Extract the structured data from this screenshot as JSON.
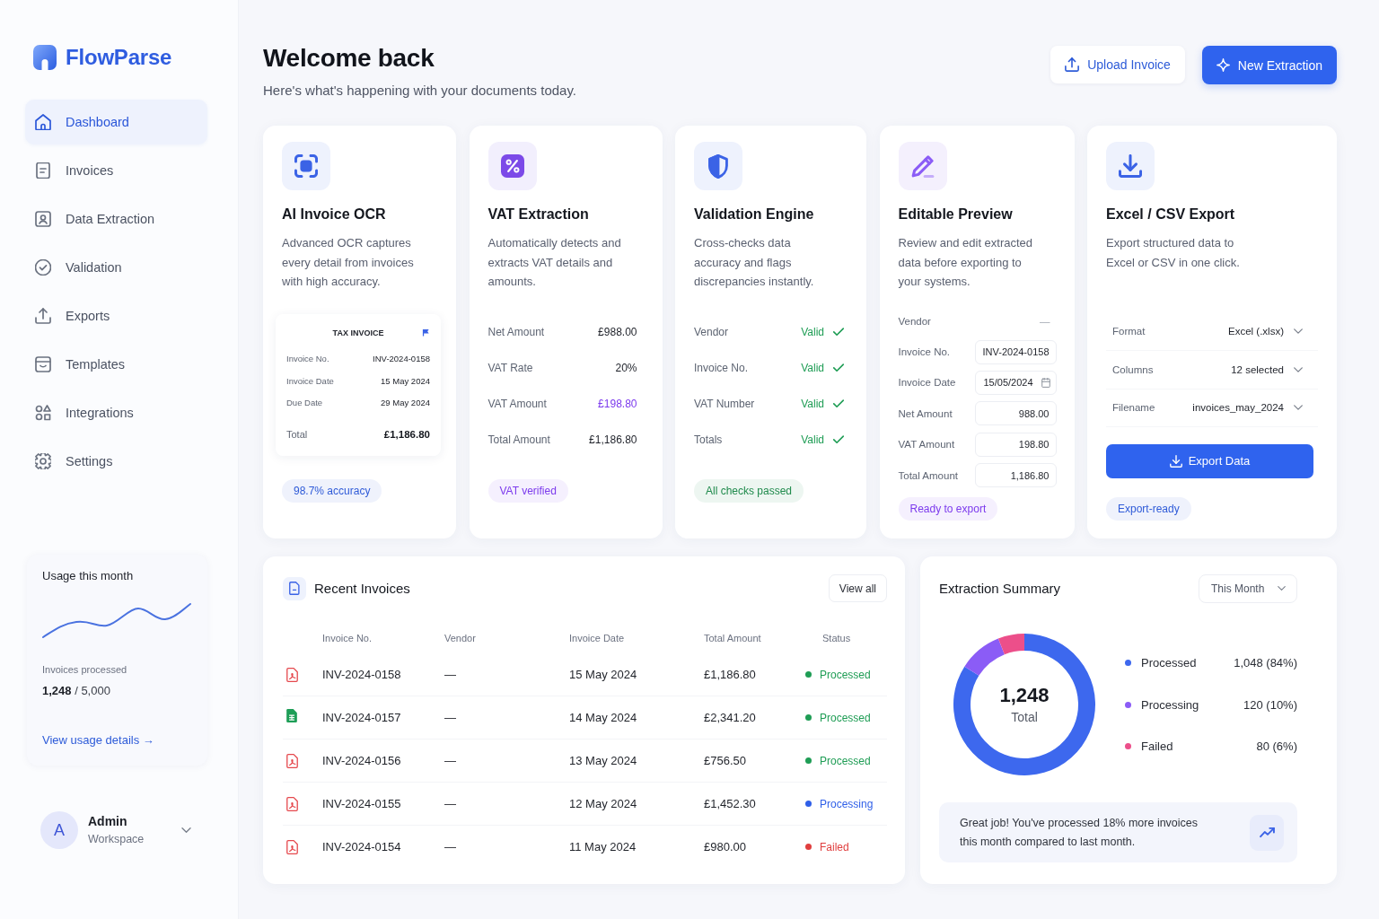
{
  "sidebar": {
    "brand": "FlowParse",
    "nav": [
      {
        "label": "Dashboard",
        "selected": true
      },
      {
        "label": "Invoices",
        "selected": false
      },
      {
        "label": "Data Extraction",
        "selected": false
      },
      {
        "label": "Validation",
        "selected": false
      },
      {
        "label": "Exports",
        "selected": false
      },
      {
        "label": "Templates",
        "selected": false
      },
      {
        "label": "Integrations",
        "selected": false
      },
      {
        "label": "Settings",
        "selected": false
      }
    ],
    "usage": {
      "title": "Usage this month",
      "caption": "Invoices processed",
      "count": "**1,248** / 5,000",
      "link": "View usage details →"
    },
    "user": {
      "initial": "A",
      "name": "Admin",
      "workspace": "Workspace"
    }
  },
  "header": {
    "title": "Welcome back",
    "subtitle": "Here's what's happening with your documents today.",
    "buttons": [
      {
        "label": "Upload Invoice",
        "kind": "secondary"
      },
      {
        "label": "New Extraction",
        "kind": "primary"
      }
    ]
  },
  "features": [
    {
      "kind": "ocr",
      "title": "AI Invoice OCR",
      "description": "Advanced OCR captures every detail from invoices with high accuracy.",
      "preview": {
        "heading": "TAX INVOICE",
        "rows": [
          {
            "label": "Invoice No.",
            "value": "INV-2024-0158"
          },
          {
            "label": "Invoice Date",
            "value": "15 May 2024"
          },
          {
            "label": "Due Date",
            "value": "29 May 2024"
          }
        ],
        "total": {
          "label": "Total",
          "value": "£1,186.80"
        }
      },
      "badge": {
        "label": "98.7% accuracy",
        "color": "#2f5bd8"
      }
    },
    {
      "kind": "amounts",
      "title": "VAT Extraction",
      "description": "Automatically detects and extracts VAT details and amounts.",
      "rows": [
        {
          "label": "Net Amount",
          "value": "£988.00",
          "accent": false
        },
        {
          "label": "VAT Rate",
          "value": "20%",
          "accent": false
        },
        {
          "label": "VAT Amount",
          "value": "£198.80",
          "accent": true
        },
        {
          "label": "Total Amount",
          "value": "£1,186.80",
          "accent": false
        }
      ],
      "badge": {
        "label": "VAT verified",
        "color": "#7c3aed"
      }
    },
    {
      "kind": "checks",
      "title": "Validation Engine",
      "description": "Cross-checks data accuracy and flags discrepancies instantly.",
      "rows": [
        {
          "label": "Vendor",
          "status": "Valid",
          "passed": true
        },
        {
          "label": "Invoice No.",
          "status": "Valid",
          "passed": true
        },
        {
          "label": "VAT Number",
          "status": "Valid",
          "passed": true
        },
        {
          "label": "Totals",
          "status": "Valid",
          "passed": true
        }
      ],
      "badge": {
        "label": "All checks passed",
        "color": "#1f8a4c"
      }
    },
    {
      "kind": "editable",
      "title": "Editable Preview",
      "description": "Review and edit extracted data before exporting to your systems.",
      "fields": [
        {
          "label": "Vendor",
          "value": "—",
          "kind": "text"
        },
        {
          "label": "Invoice No.",
          "value": "INV-2024-0158",
          "kind": "input"
        },
        {
          "label": "Invoice Date",
          "value": "15/05/2024",
          "kind": "date"
        },
        {
          "label": "Net Amount",
          "value": "988.00",
          "kind": "input"
        },
        {
          "label": "VAT Amount",
          "value": "198.80",
          "kind": "input"
        },
        {
          "label": "Total Amount",
          "value": "1,186.80",
          "kind": "input"
        }
      ],
      "badge": {
        "label": "Ready to export",
        "color": "#7c3aed"
      }
    },
    {
      "kind": "export",
      "title": "Excel / CSV Export",
      "description": "Export structured data to Excel or CSV in one click.",
      "fields": [
        {
          "label": "Format",
          "value": "Excel (.xlsx)"
        },
        {
          "label": "Columns",
          "value": "12 selected"
        },
        {
          "label": "Filename",
          "value": "invoices_may_2024"
        }
      ],
      "button": "Export Data",
      "badge": {
        "label": "Export-ready",
        "color": "#2f5bd8"
      }
    }
  ],
  "recent_invoices": {
    "title": "Recent Invoices",
    "action": "View all",
    "columns": [
      "Invoice No.",
      "Vendor",
      "Invoice Date",
      "Total Amount",
      "Status"
    ],
    "rows": [
      {
        "kind": "pdf",
        "invoice_no": "INV-2024-0158",
        "vendor": "—",
        "date": "15 May 2024",
        "amount": "£1,186.80",
        "status": {
          "label": "Processed",
          "color": "#1f9d55"
        }
      },
      {
        "kind": "sheet",
        "invoice_no": "INV-2024-0157",
        "vendor": "—",
        "date": "14 May 2024",
        "amount": "£2,341.20",
        "status": {
          "label": "Processed",
          "color": "#1f9d55"
        }
      },
      {
        "kind": "pdf",
        "invoice_no": "INV-2024-0156",
        "vendor": "—",
        "date": "13 May 2024",
        "amount": "£756.50",
        "status": {
          "label": "Processed",
          "color": "#1f9d55"
        }
      },
      {
        "kind": "pdf",
        "invoice_no": "INV-2024-0155",
        "vendor": "—",
        "date": "12 May 2024",
        "amount": "£1,452.30",
        "status": {
          "label": "Processing",
          "color": "#2f5fe8"
        }
      },
      {
        "kind": "pdf",
        "invoice_no": "INV-2024-0154",
        "vendor": "—",
        "date": "11 May 2024",
        "amount": "£980.00",
        "status": {
          "label": "Failed",
          "color": "#e03e3e"
        }
      }
    ]
  },
  "extraction_summary": {
    "title": "Extraction Summary",
    "period": "This Month",
    "center_value": "1,248",
    "center_label": "Total",
    "chart_data": {
      "type": "donut",
      "categories": [
        "Processed",
        "Processing",
        "Failed"
      ],
      "values": [
        84,
        10,
        6
      ]
    },
    "legend": [
      {
        "value": "1,048 (84%)",
        "color": "#3d68ee"
      },
      {
        "value": "120 (10%)",
        "color": "#8b5cf6"
      },
      {
        "value": "80 (6%)",
        "color": "#ec4f8a"
      }
    ],
    "note": "Great job! You've processed 18% more invoices this month compared to last month."
  }
}
